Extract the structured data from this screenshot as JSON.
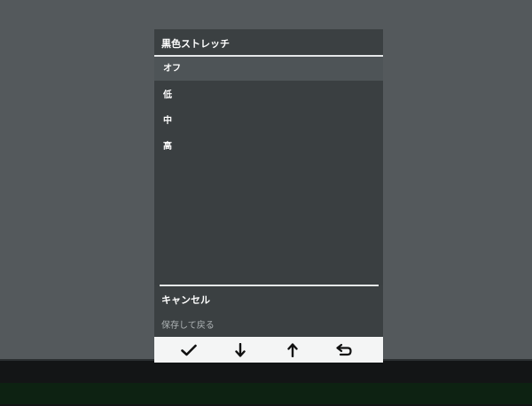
{
  "osd": {
    "title": "黒色ストレッチ",
    "selected_option": "オフ",
    "options": [
      "低",
      "中",
      "高"
    ],
    "cancel_label": "キャンセル",
    "save_label": "保存して戻る",
    "buttons": [
      {
        "icon": "checkmark-icon"
      },
      {
        "icon": "arrow-down-icon"
      },
      {
        "icon": "arrow-up-icon"
      },
      {
        "icon": "return-icon"
      }
    ]
  }
}
